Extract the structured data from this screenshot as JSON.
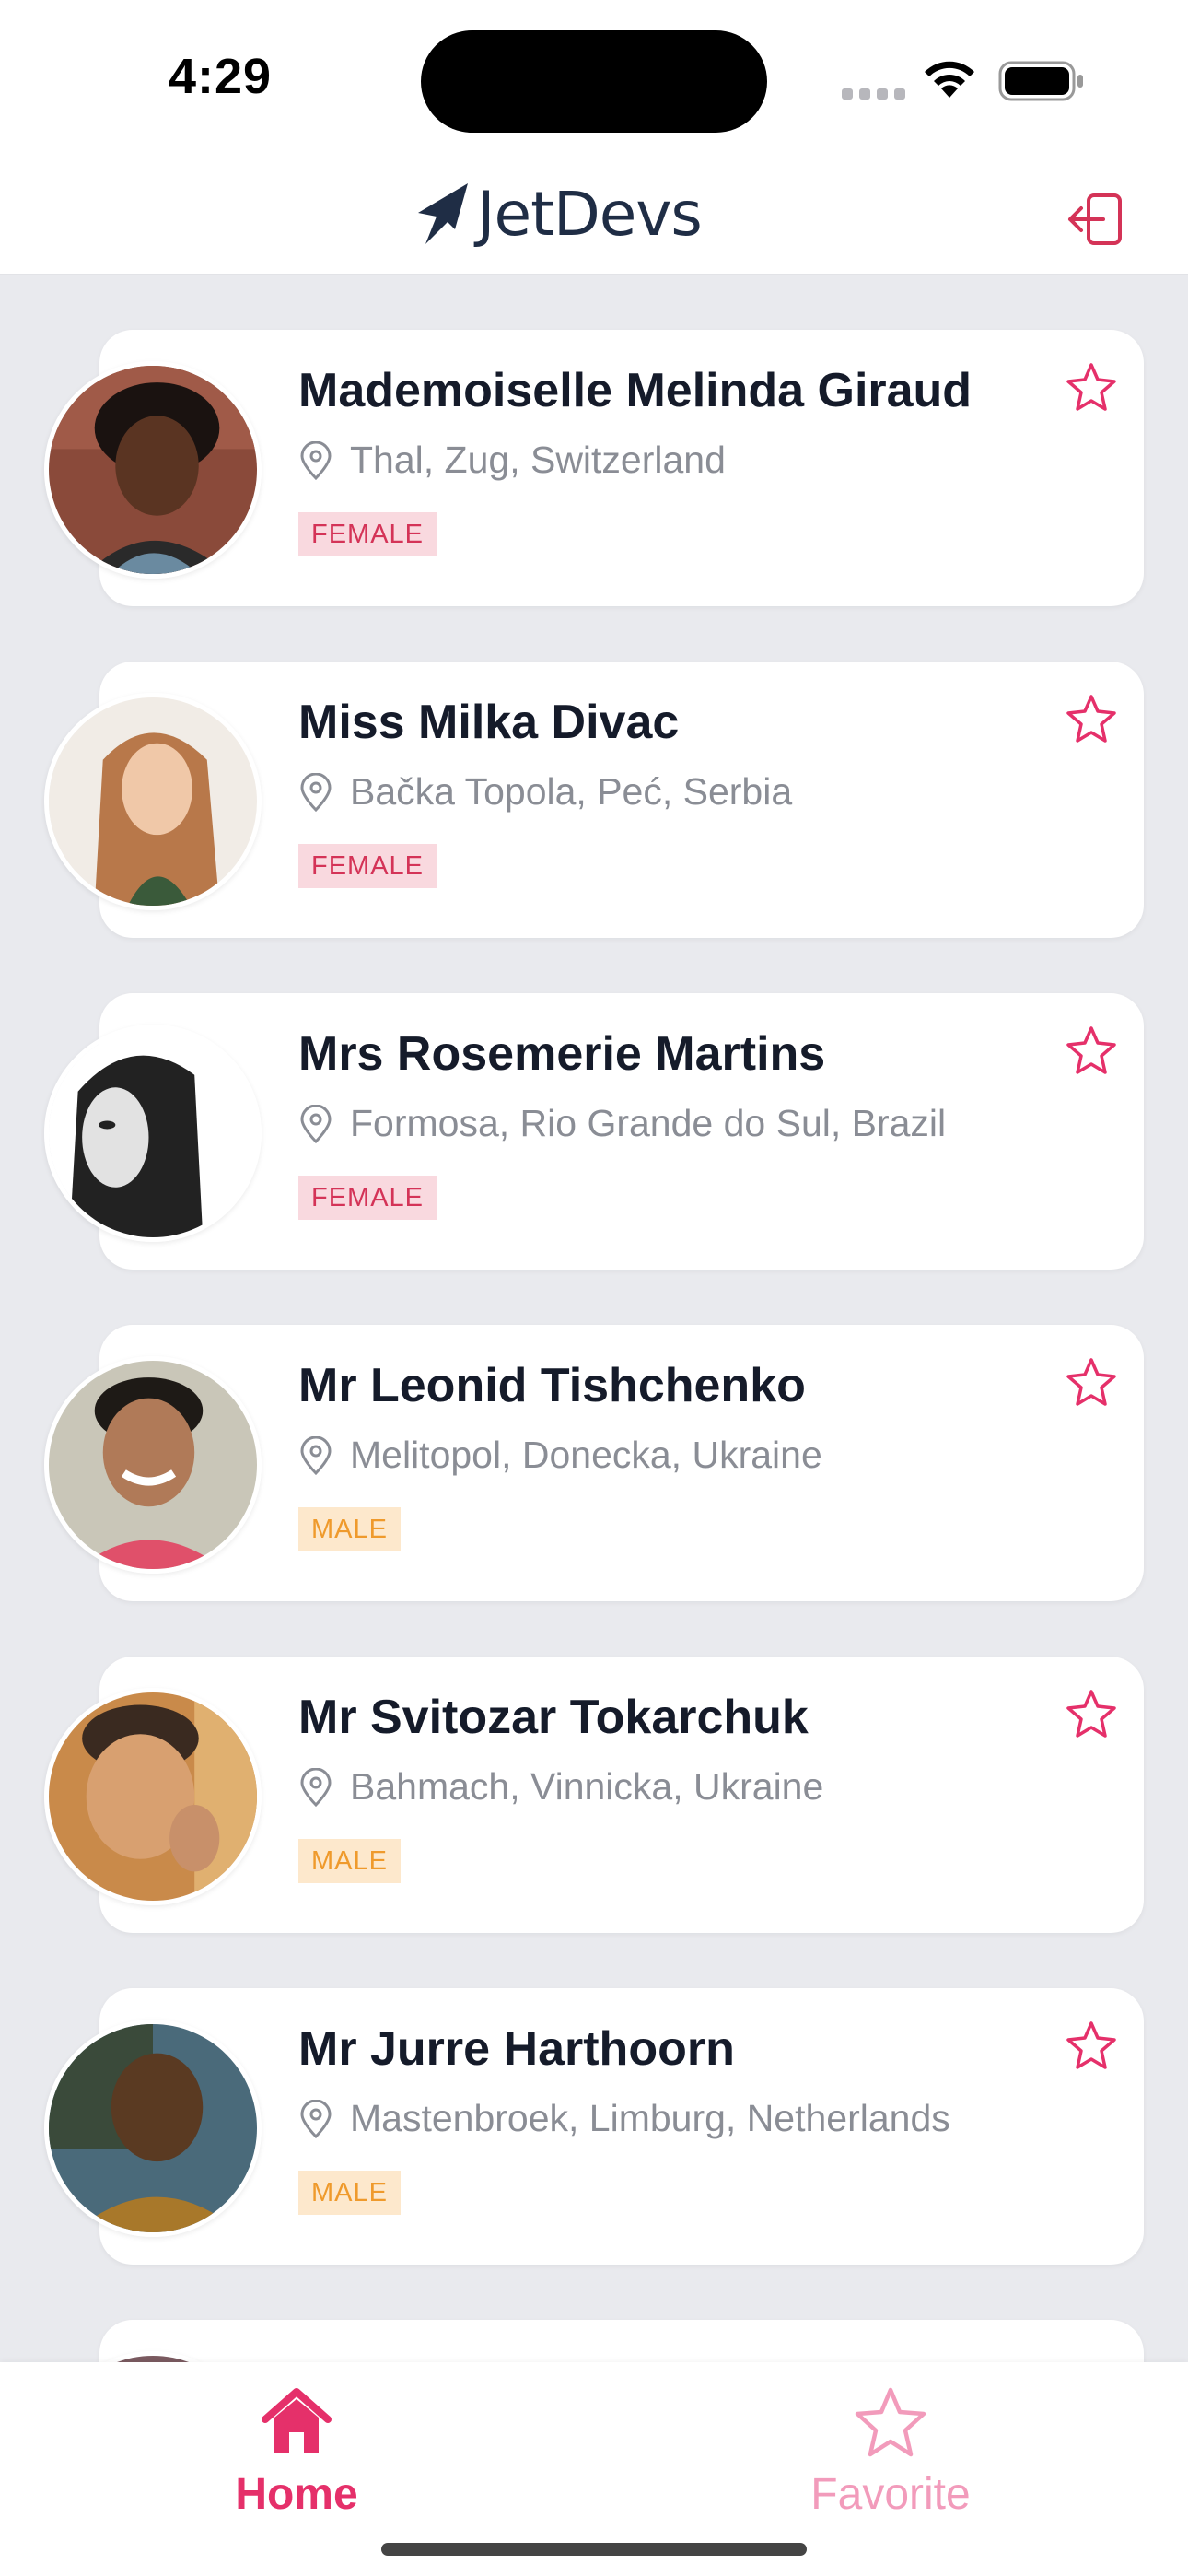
{
  "status": {
    "time": "4:29"
  },
  "header": {
    "brand": "JetDevs",
    "logout_icon": "logout-icon"
  },
  "colors": {
    "accent": "#e5306a",
    "female_bg": "#f9d9df",
    "female_text": "#d43357",
    "male_bg": "#fde8cc",
    "male_text": "#ef9a2c",
    "background": "#e9eaee"
  },
  "users": [
    {
      "name": "Mademoiselle Melinda Giraud",
      "location": "Thal, Zug, Switzerland",
      "gender": "FEMALE"
    },
    {
      "name": "Miss Milka Divac",
      "location": "Bačka Topola, Peć, Serbia",
      "gender": "FEMALE"
    },
    {
      "name": "Mrs Rosemerie Martins",
      "location": "Formosa, Rio Grande do Sul, Brazil",
      "gender": "FEMALE"
    },
    {
      "name": "Mr Leonid Tishchenko",
      "location": "Melitopol, Donecka, Ukraine",
      "gender": "MALE"
    },
    {
      "name": "Mr Svitozar Tokarchuk",
      "location": "Bahmach, Vinnicka, Ukraine",
      "gender": "MALE"
    },
    {
      "name": "Mr Jurre Harthoorn",
      "location": "Mastenbroek, Limburg, Netherlands",
      "gender": "MALE"
    }
  ],
  "tabs": {
    "home": "Home",
    "favorite": "Favorite"
  }
}
